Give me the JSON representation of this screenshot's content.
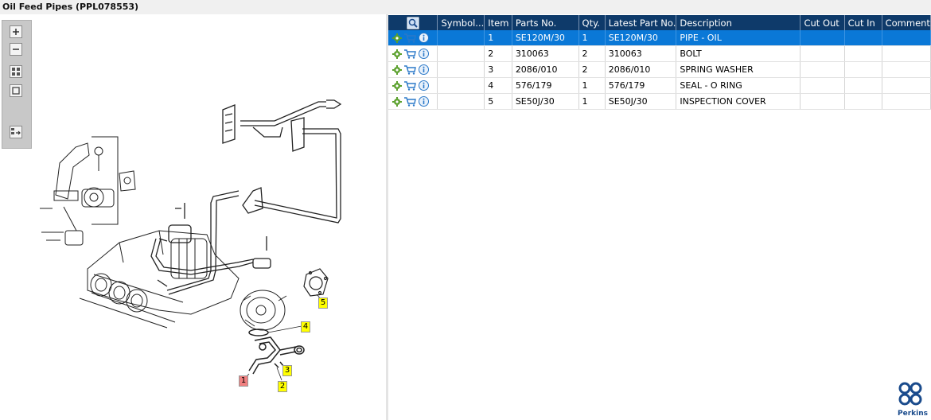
{
  "window": {
    "title": "Oil Feed Pipes (PPL078553)"
  },
  "toolbar": {
    "buttons": [
      {
        "name": "zoom-in",
        "icon": "plus-icon"
      },
      {
        "name": "zoom-out",
        "icon": "minus-icon"
      },
      {
        "name": "fit-all",
        "icon": "grid-icon"
      },
      {
        "name": "fit-window",
        "icon": "square-icon"
      },
      {
        "name": "split-view",
        "icon": "panel-arrow-icon"
      }
    ]
  },
  "diagram": {
    "callouts": [
      {
        "label": "1",
        "color": "#f08080"
      },
      {
        "label": "2",
        "color": "#ffff00"
      },
      {
        "label": "3",
        "color": "#ffff00"
      },
      {
        "label": "4",
        "color": "#ffff00"
      },
      {
        "label": "5",
        "color": "#ffff00"
      }
    ]
  },
  "table": {
    "columns": [
      "Symbol...",
      "Item",
      "Parts No.",
      "Qty.",
      "Latest Part No.",
      "Description",
      "Cut Out",
      "Cut In",
      "Comment"
    ],
    "rows": [
      {
        "item": "1",
        "part_no": "SE120M/30",
        "qty": "1",
        "latest": "SE120M/30",
        "desc": "PIPE - OIL",
        "selected": true
      },
      {
        "item": "2",
        "part_no": "310063",
        "qty": "2",
        "latest": "310063",
        "desc": "BOLT",
        "selected": false
      },
      {
        "item": "3",
        "part_no": "2086/010",
        "qty": "2",
        "latest": "2086/010",
        "desc": "SPRING WASHER",
        "selected": false
      },
      {
        "item": "4",
        "part_no": "576/179",
        "qty": "1",
        "latest": "576/179",
        "desc": "SEAL - O RING",
        "selected": false
      },
      {
        "item": "5",
        "part_no": "SE50J/30",
        "qty": "1",
        "latest": "SE50J/30",
        "desc": "INSPECTION COVER",
        "selected": false
      }
    ]
  },
  "brand": {
    "name": "Perkins",
    "color": "#1a4b8c"
  },
  "colors": {
    "header": "#0e3a6a",
    "selected_row": "#0a78d7"
  }
}
